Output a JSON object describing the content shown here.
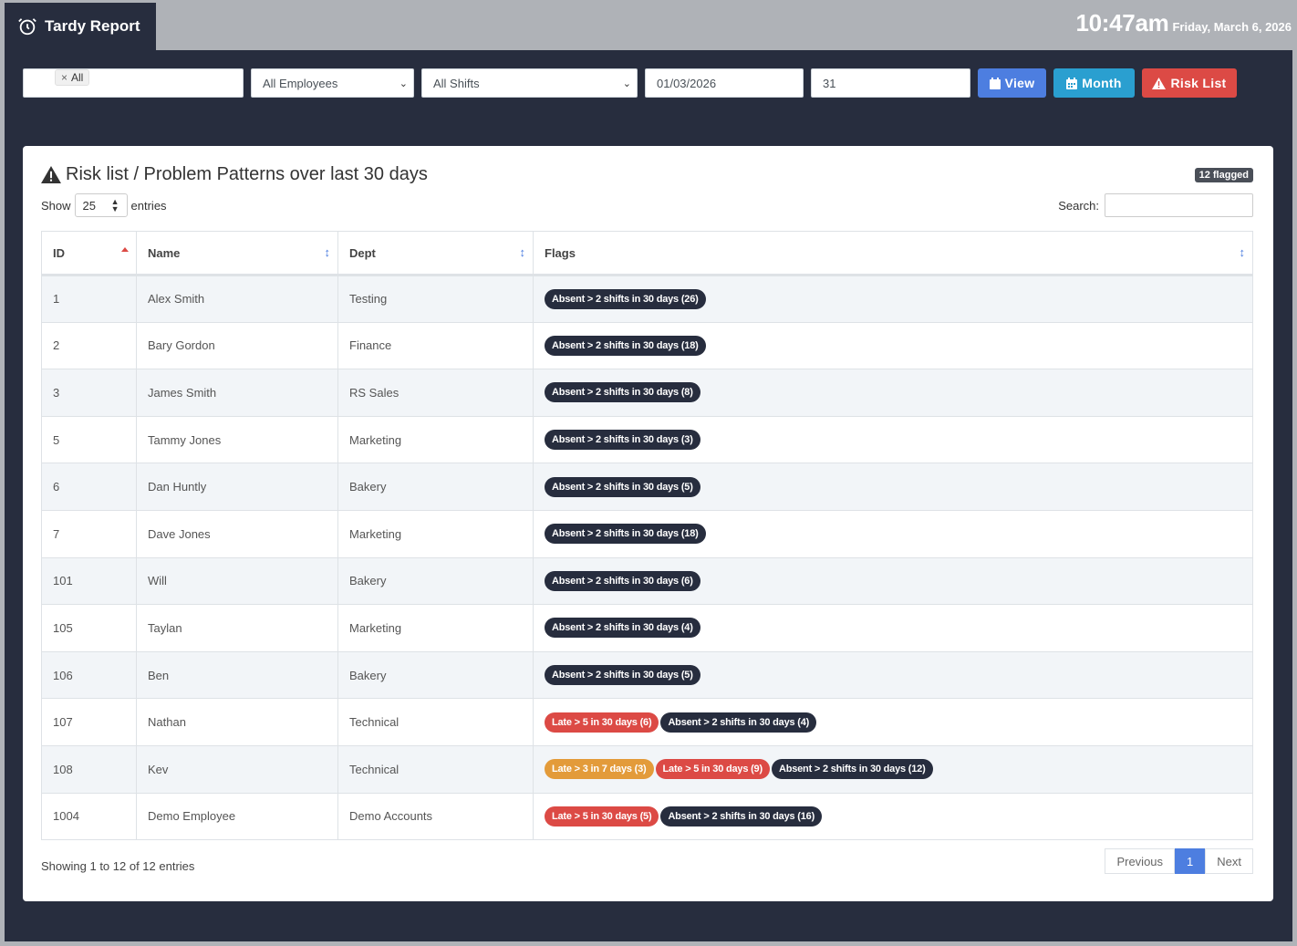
{
  "app": {
    "title": "Tardy Report"
  },
  "clock": {
    "time": "10:47am",
    "date": "Friday, March 6, 2026"
  },
  "filters": {
    "tag": "All",
    "employees": "All Employees",
    "shifts": "All Shifts",
    "date": "01/03/2026",
    "days": "31"
  },
  "buttons": {
    "view": "View",
    "month": "Month",
    "risk": "Risk List"
  },
  "card": {
    "title": "Risk list / Problem Patterns over last 30 days",
    "flagged": "12 flagged",
    "show": "Show",
    "entries_value": "25",
    "entries": "entries",
    "search": "Search:"
  },
  "table": {
    "headers": [
      "ID",
      "Name",
      "Dept",
      "Flags"
    ],
    "rows": [
      {
        "id": "1",
        "name": "Alex Smith",
        "dept": "Testing",
        "flags": [
          {
            "text": "Absent > 2 shifts in 30 days (26)",
            "type": "dark"
          }
        ]
      },
      {
        "id": "2",
        "name": "Bary Gordon",
        "dept": "Finance",
        "flags": [
          {
            "text": "Absent > 2 shifts in 30 days (18)",
            "type": "dark"
          }
        ]
      },
      {
        "id": "3",
        "name": "James Smith",
        "dept": "RS Sales",
        "flags": [
          {
            "text": "Absent > 2 shifts in 30 days (8)",
            "type": "dark"
          }
        ]
      },
      {
        "id": "5",
        "name": "Tammy Jones",
        "dept": "Marketing",
        "flags": [
          {
            "text": "Absent > 2 shifts in 30 days (3)",
            "type": "dark"
          }
        ]
      },
      {
        "id": "6",
        "name": "Dan Huntly",
        "dept": "Bakery",
        "flags": [
          {
            "text": "Absent > 2 shifts in 30 days (5)",
            "type": "dark"
          }
        ]
      },
      {
        "id": "7",
        "name": "Dave Jones",
        "dept": "Marketing",
        "flags": [
          {
            "text": "Absent > 2 shifts in 30 days (18)",
            "type": "dark"
          }
        ]
      },
      {
        "id": "101",
        "name": "Will",
        "dept": "Bakery",
        "flags": [
          {
            "text": "Absent > 2 shifts in 30 days (6)",
            "type": "dark"
          }
        ]
      },
      {
        "id": "105",
        "name": "Taylan",
        "dept": "Marketing",
        "flags": [
          {
            "text": "Absent > 2 shifts in 30 days (4)",
            "type": "dark"
          }
        ]
      },
      {
        "id": "106",
        "name": "Ben",
        "dept": "Bakery",
        "flags": [
          {
            "text": "Absent > 2 shifts in 30 days (5)",
            "type": "dark"
          }
        ]
      },
      {
        "id": "107",
        "name": "Nathan",
        "dept": "Technical",
        "flags": [
          {
            "text": "Late > 5 in 30 days (6)",
            "type": "danger"
          },
          {
            "text": "Absent > 2 shifts in 30 days (4)",
            "type": "dark"
          }
        ]
      },
      {
        "id": "108",
        "name": "Kev",
        "dept": "Technical",
        "flags": [
          {
            "text": "Late > 3 in 7 days (3)",
            "type": "warning"
          },
          {
            "text": "Late > 5 in 30 days (9)",
            "type": "danger"
          },
          {
            "text": "Absent > 2 shifts in 30 days (12)",
            "type": "dark"
          }
        ]
      },
      {
        "id": "1004",
        "name": "Demo Employee",
        "dept": "Demo Accounts",
        "flags": [
          {
            "text": "Late > 5 in 30 days (5)",
            "type": "danger"
          },
          {
            "text": "Absent > 2 shifts in 30 days (16)",
            "type": "dark"
          }
        ]
      }
    ]
  },
  "footer": {
    "info": "Showing 1 to 12 of 12 entries",
    "previous": "Previous",
    "page": "1",
    "next": "Next"
  },
  "colors": {
    "dark": "#272d3e",
    "primary": "#4d7ee0",
    "info": "#2a9fd0",
    "danger": "#dc4a45",
    "warning": "#e39b3a"
  }
}
